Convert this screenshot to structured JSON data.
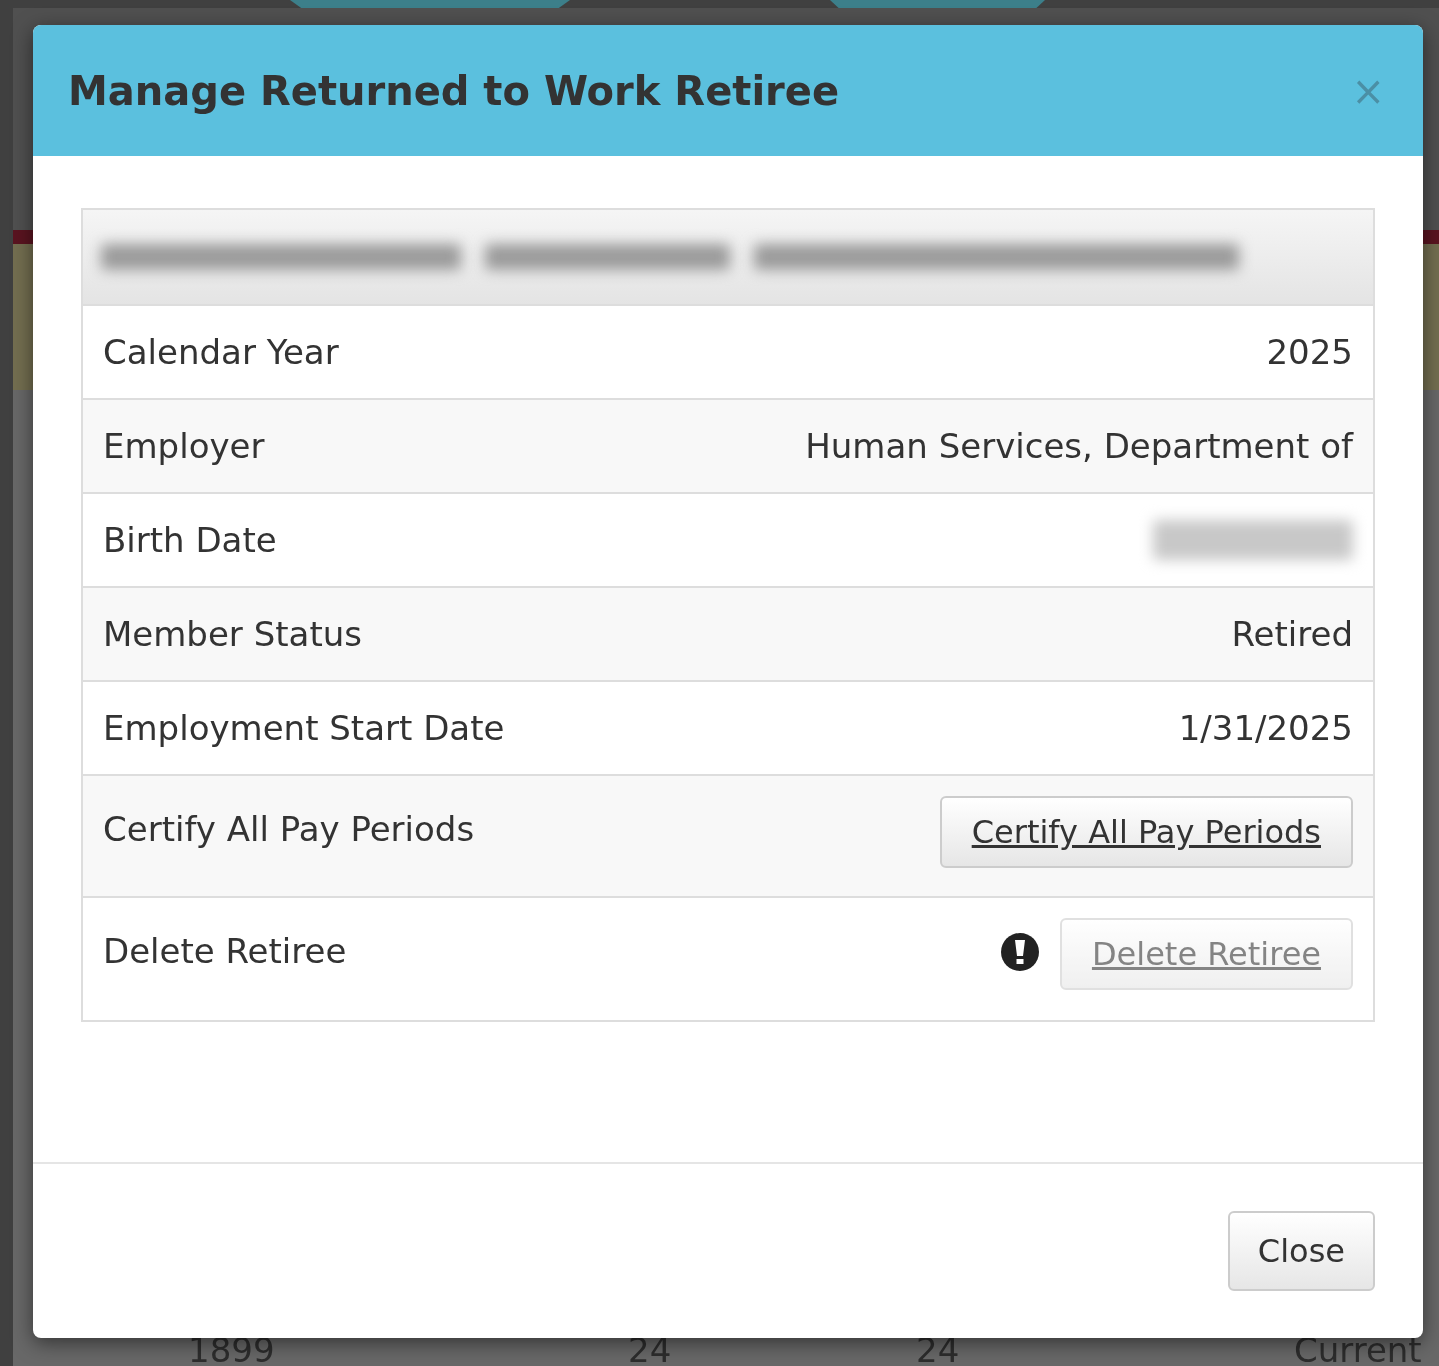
{
  "background_page": {
    "bottom_row": [
      "1899",
      "24",
      "24",
      "Current"
    ]
  },
  "dialog": {
    "title": "Manage Returned to Work Retiree",
    "close_glyph": "×",
    "panel": {
      "heading": {
        "kind": "redacted"
      },
      "rows": [
        {
          "kind": "value",
          "label": "Calendar Year",
          "value": "2025"
        },
        {
          "kind": "value",
          "label": "Employer",
          "value": "Human Services, Department of"
        },
        {
          "kind": "redacted",
          "label": "Birth Date"
        },
        {
          "kind": "value",
          "label": "Member Status",
          "value": "Retired"
        },
        {
          "kind": "value",
          "label": "Employment Start Date",
          "value": "1/31/2025"
        },
        {
          "kind": "button",
          "label": "Certify All Pay Periods",
          "button": "Certify All Pay Periods",
          "disabled": false,
          "warning": false
        },
        {
          "kind": "button",
          "label": "Delete Retiree",
          "button": "Delete Retiree",
          "disabled": true,
          "warning": true
        }
      ]
    },
    "footer_buttons": [
      "Close"
    ]
  }
}
